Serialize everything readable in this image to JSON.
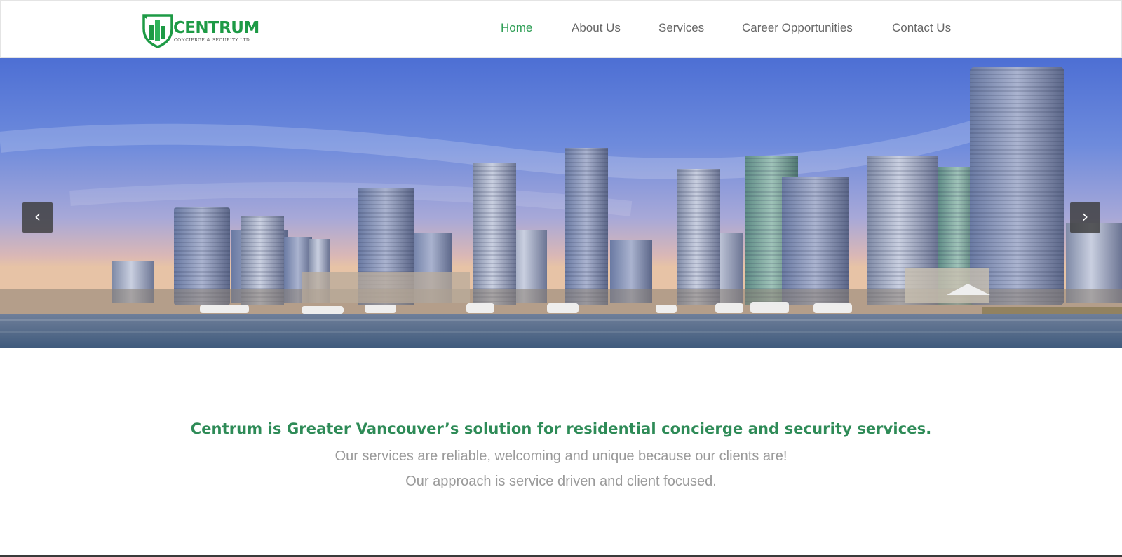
{
  "brand": {
    "name": "CENTRUM",
    "tagline": "CONCIERGE & SECURITY LTD.",
    "color": "#1d9a45"
  },
  "nav": {
    "items": [
      {
        "label": "Home",
        "active": true
      },
      {
        "label": "About Us",
        "active": false
      },
      {
        "label": "Services",
        "active": false
      },
      {
        "label": "Career Opportunities",
        "active": false
      },
      {
        "label": "Contact Us",
        "active": false
      }
    ],
    "active_color": "#2e9e55",
    "text_color": "#666666"
  },
  "hero": {
    "image_subject": "Vancouver waterfront skyline with marina",
    "prev_icon": "chevron-left-icon",
    "prev_glyph": "‹",
    "next_icon": "chevron-right-icon",
    "next_glyph": "›"
  },
  "intro": {
    "headline": "Centrum is Greater Vancouver’s solution for residential concierge and security services.",
    "line1": "Our services are reliable, welcoming and unique because our clients are!",
    "line2": "Our approach is service driven and client focused.",
    "headline_color": "#2e8b57",
    "body_color": "#9a9a9a"
  }
}
